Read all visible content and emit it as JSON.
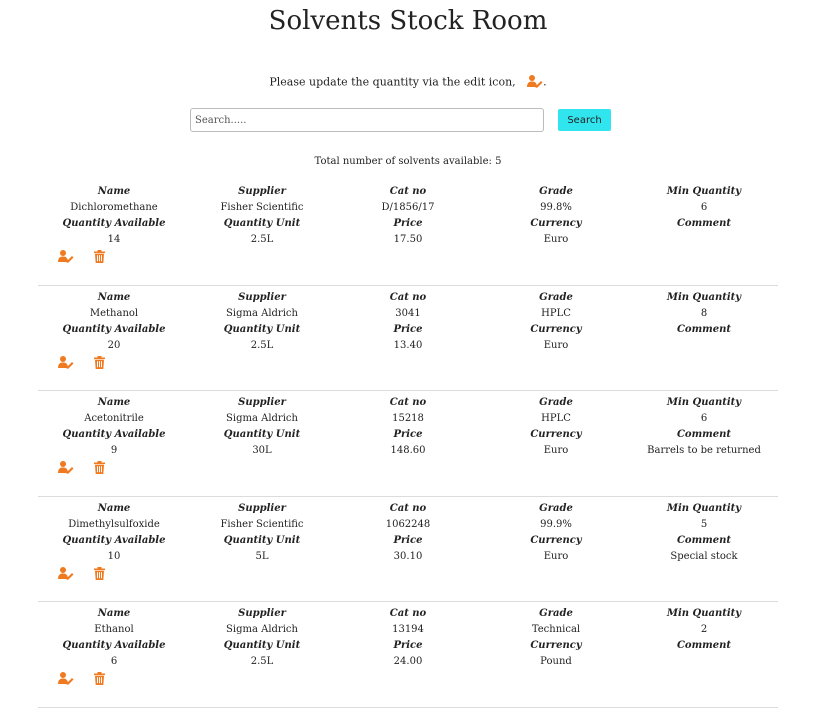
{
  "page": {
    "title": "Solvents Stock Room"
  },
  "instructions": "Please update the quantity via the edit icon,",
  "instructions_end": ".",
  "search": {
    "placeholder": "Search.....",
    "button_label": "Search"
  },
  "total": {
    "label": "Total number of solvents available:",
    "count": "5"
  },
  "field_labels": {
    "name": "Name",
    "supplier": "Supplier",
    "cat_no": "Cat no",
    "grade": "Grade",
    "min_quantity": "Min Quantity",
    "quantity_available": "Quantity Available",
    "quantity_unit": "Quantity Unit",
    "price": "Price",
    "currency": "Currency",
    "comment": "Comment"
  },
  "icons": {
    "edit": "user-edit-icon",
    "delete": "trash-icon"
  },
  "colors": {
    "accent_orange": "#f07a1f",
    "search_button": "#31e5ee"
  },
  "solvents": [
    {
      "name": "Dichloromethane",
      "supplier": "Fisher Scientific",
      "cat_no": "D/1856/17",
      "grade": "99.8%",
      "min_quantity": "6",
      "quantity_available": "14",
      "quantity_unit": "2.5L",
      "price": "17.50",
      "currency": "Euro",
      "comment": ""
    },
    {
      "name": "Methanol",
      "supplier": "Sigma Aldrich",
      "cat_no": "3041",
      "grade": "HPLC",
      "min_quantity": "8",
      "quantity_available": "20",
      "quantity_unit": "2.5L",
      "price": "13.40",
      "currency": "Euro",
      "comment": ""
    },
    {
      "name": "Acetonitrile",
      "supplier": "Sigma Aldrich",
      "cat_no": "15218",
      "grade": "HPLC",
      "min_quantity": "6",
      "quantity_available": "9",
      "quantity_unit": "30L",
      "price": "148.60",
      "currency": "Euro",
      "comment": "Barrels to be returned"
    },
    {
      "name": "Dimethylsulfoxide",
      "supplier": "Fisher Scientific",
      "cat_no": "1062248",
      "grade": "99.9%",
      "min_quantity": "5",
      "quantity_available": "10",
      "quantity_unit": "5L",
      "price": "30.10",
      "currency": "Euro",
      "comment": "Special stock"
    },
    {
      "name": "Ethanol",
      "supplier": "Sigma Aldrich",
      "cat_no": "13194",
      "grade": "Technical",
      "min_quantity": "2",
      "quantity_available": "6",
      "quantity_unit": "2.5L",
      "price": "24.00",
      "currency": "Pound",
      "comment": ""
    }
  ]
}
